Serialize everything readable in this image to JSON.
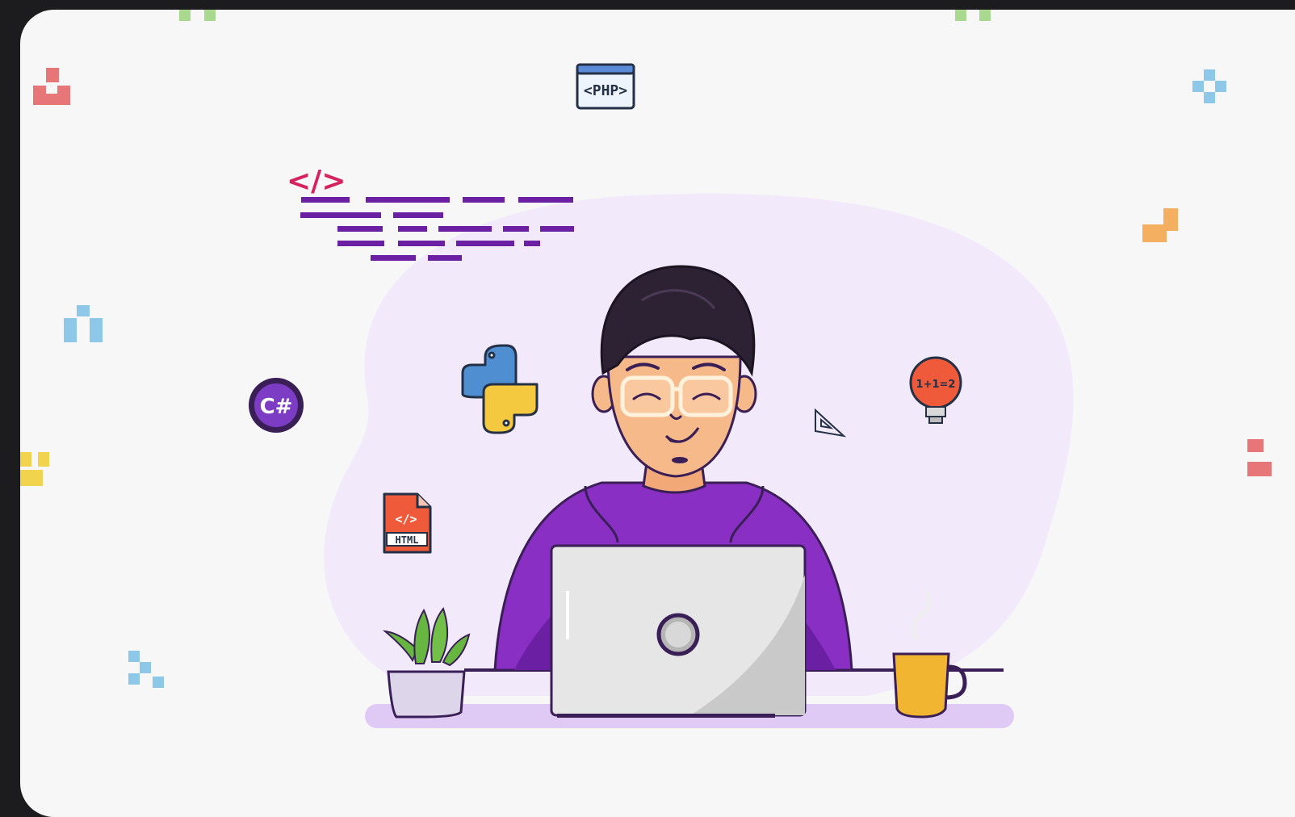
{
  "illustration": {
    "php_badge_label": "<PHP>",
    "code_tag_label": "</>",
    "csharp_label": "C#",
    "html_file_tag": "</>",
    "html_file_label": "HTML",
    "bulb_equation": "1+1=2"
  },
  "colors": {
    "background": "#f7f7f8",
    "blob": "#f1e9fb",
    "shirt": "#8a2fc4",
    "shirt_dark": "#6b1fa3",
    "desk": "#dfc9f5",
    "code_lines": "#6b1fa3",
    "code_tag": "#d6235f",
    "hair": "#2d2233",
    "skin": "#f6b98a",
    "glasses": "#fff2dc",
    "laptop": "#e6e6e6",
    "mug": "#f2b531",
    "plant": "#66b640",
    "bulb": "#ef5a3a",
    "python_blue": "#4f8fd1",
    "python_yellow": "#f4c93f",
    "csharp": "#7c3cc4"
  }
}
